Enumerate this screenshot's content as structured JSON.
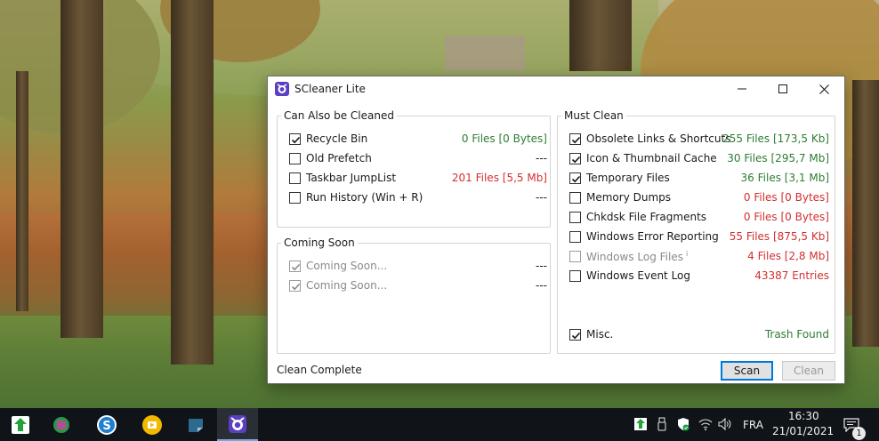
{
  "window": {
    "title": "SCleaner Lite",
    "controls": [
      "minimize",
      "maximize",
      "close"
    ]
  },
  "can_also_be_cleaned": {
    "title": "Can Also be Cleaned",
    "items": [
      {
        "label": "Recycle Bin",
        "checked": true,
        "value": "0 Files [0 Bytes]",
        "color": "#2e7d32"
      },
      {
        "label": "Old Prefetch",
        "checked": false,
        "value": "---",
        "color": "#1a1a1a"
      },
      {
        "label": "Taskbar JumpList",
        "checked": false,
        "value": "201 Files [5,5 Mb]",
        "color": "#d32f2f"
      },
      {
        "label": "Run History (Win + R)",
        "checked": false,
        "value": "---",
        "color": "#1a1a1a"
      }
    ]
  },
  "coming_soon": {
    "title": "Coming Soon",
    "items": [
      {
        "label": "Coming Soon...",
        "checked": true,
        "value": "---"
      },
      {
        "label": "Coming Soon...",
        "checked": true,
        "value": "---"
      }
    ]
  },
  "must_clean": {
    "title": "Must Clean",
    "items": [
      {
        "label": "Obsolete Links & Shortcuts",
        "checked": true,
        "value": "255 Files [173,5 Kb]",
        "color": "#2e7d32"
      },
      {
        "label": "Icon & Thumbnail Cache",
        "checked": true,
        "value": "30 Files [295,7 Mb]",
        "color": "#2e7d32"
      },
      {
        "label": "Temporary Files",
        "checked": true,
        "value": "36 Files [3,1 Mb]",
        "color": "#2e7d32"
      },
      {
        "label": "Memory Dumps",
        "checked": false,
        "value": "0 Files [0 Bytes]",
        "color": "#d32f2f"
      },
      {
        "label": "Chkdsk File Fragments",
        "checked": false,
        "value": "0 Files [0 Bytes]",
        "color": "#d32f2f"
      },
      {
        "label": "Windows Error Reporting",
        "checked": false,
        "value": "55 Files [875,5 Kb]",
        "color": "#d32f2f"
      },
      {
        "label": "Windows Log Files",
        "superscript": "i",
        "checked": false,
        "disabled": true,
        "value": "4 Files [2,8 Mb]",
        "color": "#d32f2f"
      },
      {
        "label": "Windows Event Log",
        "checked": false,
        "value": "43387 Entries",
        "color": "#d32f2f"
      }
    ],
    "misc": {
      "label": "Misc.",
      "checked": true,
      "value": "Trash Found",
      "color": "#2e7d32"
    }
  },
  "status": "Clean Complete",
  "buttons": {
    "scan": "Scan",
    "clean": "Clean"
  },
  "taskbar": {
    "apps": [
      "green-upload-app-icon",
      "spreadsheet-app-icon",
      "sync-s-app-icon",
      "yellow-media-app-icon",
      "sticky-notes-app-icon",
      "scleaner-app-icon"
    ],
    "tray": {
      "language": "FRA",
      "time": "16:30",
      "date": "21/01/2021",
      "notifications": "1"
    }
  }
}
